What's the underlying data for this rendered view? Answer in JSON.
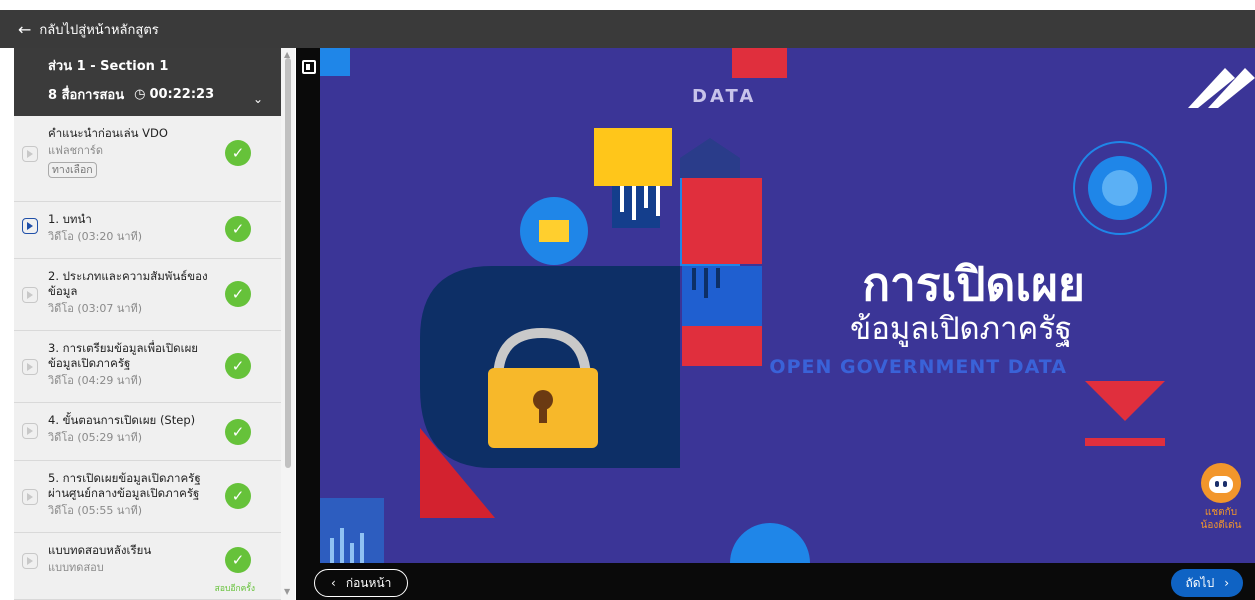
{
  "topbar": {
    "back_label": "กลับไปสู่หน้าหลักสูตร"
  },
  "section": {
    "title": "ส่วน 1 - Section 1",
    "media_count": "8 สื่อการสอน",
    "duration": "00:22:23"
  },
  "lessons": [
    {
      "title": "คำแนะนำก่อนเล่น VDO",
      "sub": "แฟลชการ์ด",
      "optional": "ทางเลือก",
      "icon": "flashcard-icon",
      "completed": true
    },
    {
      "title": "1. บทนำ",
      "sub": "วิดีโอ (03:20 นาที)",
      "icon": "video-icon",
      "active": true,
      "completed": true
    },
    {
      "title": "2. ประเภทและความสัมพันธ์ของข้อมูล",
      "sub": "วิดีโอ (03:07 นาที)",
      "icon": "video-icon",
      "completed": true
    },
    {
      "title": "3. การเตรียมข้อมูลเพื่อเปิดเผยข้อมูลเปิดภาครัฐ",
      "sub": "วิดีโอ (04:29 นาที)",
      "icon": "video-icon",
      "completed": true
    },
    {
      "title": "4. ขั้นตอนการเปิดเผย (Step)",
      "sub": "วิดีโอ (05:29 นาที)",
      "icon": "video-icon",
      "completed": true
    },
    {
      "title": "5. การเปิดเผยข้อมูลเปิดภาครัฐผ่านศูนย์กลางข้อมูลเปิดภาครัฐ",
      "sub": "วิดีโอ (05:55 นาที)",
      "icon": "video-icon",
      "completed": true
    },
    {
      "title": "แบบทดสอบหลังเรียน",
      "sub": "แบบทดสอบ",
      "icon": "quiz-icon",
      "completed": true,
      "retake": "สอบอีกครั้ง"
    }
  ],
  "video": {
    "data_label": "DATA",
    "title_th_line1": "การเปิดเผย",
    "title_th_line2": "ข้อมูลเปิดภาครัฐ",
    "title_en": "OPEN GOVERNMENT DATA"
  },
  "nav": {
    "prev_label": "ก่อนหน้า",
    "next_label": "ถัดไป"
  },
  "chatbot": {
    "line1": "แชตกับ",
    "line2": "น้องดีเด่น"
  },
  "colors": {
    "accent": "#0f63c4",
    "success": "#66c23a",
    "video_bg": "#3b3597",
    "chatbot": "#f2962b"
  }
}
